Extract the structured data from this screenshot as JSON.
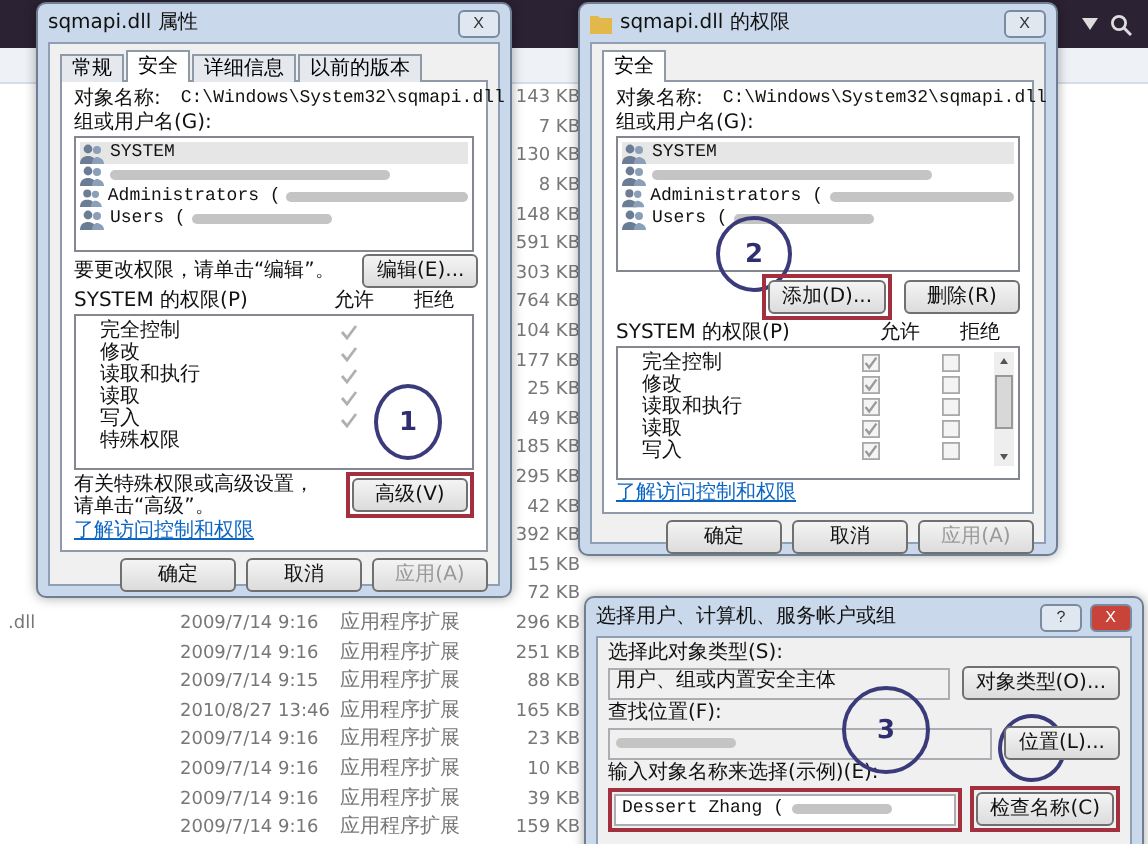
{
  "explorer": {
    "rows": [
      {
        "size": "143 KB"
      },
      {
        "size": "7 KB"
      },
      {
        "size": "130 KB"
      },
      {
        "size": "8 KB"
      },
      {
        "size": "148 KB"
      },
      {
        "size": "591 KB"
      },
      {
        "size": "303 KB"
      },
      {
        "size": "764 KB"
      },
      {
        "size": "104 KB"
      },
      {
        "size": "177 KB"
      },
      {
        "size": "25 KB"
      },
      {
        "size": "49 KB"
      },
      {
        "size": "185 KB"
      },
      {
        "size": "295 KB"
      },
      {
        "size": "42 KB"
      },
      {
        "size": "392 KB"
      },
      {
        "size": "15 KB"
      },
      {
        "size": "72 KB"
      },
      {
        "name": ".dll",
        "date": "2009/7/14 9:16",
        "type": "应用程序扩展",
        "size": "296 KB"
      },
      {
        "date": "2009/7/14 9:16",
        "type": "应用程序扩展",
        "size": "251 KB"
      },
      {
        "date": "2009/7/14 9:15",
        "type": "应用程序扩展",
        "size": "88 KB"
      },
      {
        "date": "2010/8/27 13:46",
        "type": "应用程序扩展",
        "size": "165 KB"
      },
      {
        "date": "2009/7/14 9:16",
        "type": "应用程序扩展",
        "size": "23 KB"
      },
      {
        "date": "2009/7/14 9:16",
        "type": "应用程序扩展",
        "size": "10 KB"
      },
      {
        "date": "2009/7/14 9:16",
        "type": "应用程序扩展",
        "size": "39 KB"
      },
      {
        "date": "2009/7/14 9:16",
        "type": "应用程序扩展",
        "size": "159 KB"
      }
    ]
  },
  "properties_dialog": {
    "title": "sqmapi.dll 属性",
    "close": "X",
    "tabs": [
      {
        "label": "常规",
        "selected": false
      },
      {
        "label": "安全",
        "selected": true
      },
      {
        "label": "详细信息",
        "selected": false
      },
      {
        "label": "以前的版本",
        "selected": false
      }
    ],
    "object_label": "对象名称:",
    "object_path": "C:\\Windows\\System32\\sqmapi.dll",
    "users_label": "组或用户名(G):",
    "users": [
      {
        "name": "SYSTEM",
        "blurred": false,
        "selected": true
      },
      {
        "blurred": true,
        "selected": false
      },
      {
        "name": "Administrators (",
        "blurred": true,
        "selected": false
      },
      {
        "name": "Users (",
        "blurred": true,
        "selected": false
      }
    ],
    "edit_hint": "要更改权限，请单击“编辑”。",
    "edit_button": {
      "label": "编辑(E)...",
      "highlighted": false
    },
    "perm_title": "SYSTEM 的权限(P)",
    "allow_header": "允许",
    "deny_header": "拒绝",
    "permissions": [
      {
        "label": "完全控制",
        "allow": true,
        "deny": false
      },
      {
        "label": "修改",
        "allow": true,
        "deny": false
      },
      {
        "label": "读取和执行",
        "allow": true,
        "deny": false
      },
      {
        "label": "读取",
        "allow": true,
        "deny": false
      },
      {
        "label": "写入",
        "allow": true,
        "deny": false
      },
      {
        "label": "特殊权限",
        "allow": false,
        "deny": false
      }
    ],
    "advanced_hint": "有关特殊权限或高级设置，请单击“高级”。",
    "advanced_button": {
      "label": "高级(V)",
      "highlighted": true
    },
    "link": "了解访问控制和权限",
    "annotation": "1",
    "buttons": [
      {
        "label": "确定",
        "disabled": false
      },
      {
        "label": "取消",
        "disabled": false
      },
      {
        "label": "应用(A)",
        "disabled": true
      }
    ]
  },
  "permissions_dialog": {
    "title": "sqmapi.dll 的权限",
    "close": "X",
    "tab": "安全",
    "object_label": "对象名称:",
    "object_path": "C:\\Windows\\System32\\sqmapi.dll",
    "users_label": "组或用户名(G):",
    "users": [
      {
        "name": "SYSTEM",
        "blurred": false,
        "selected": true
      },
      {
        "blurred": true,
        "selected": false
      },
      {
        "name": "Administrators (",
        "blurred": true,
        "selected": false
      },
      {
        "name": "Users (",
        "blurred": true,
        "selected": false
      }
    ],
    "add_button": {
      "label": "添加(D)...",
      "highlighted": true
    },
    "remove_button": {
      "label": "删除(R)",
      "highlighted": false
    },
    "perm_title": "SYSTEM 的权限(P)",
    "allow_header": "允许",
    "deny_header": "拒绝",
    "permissions": [
      {
        "label": "完全控制",
        "allow": true,
        "deny": false
      },
      {
        "label": "修改",
        "allow": true,
        "deny": false
      },
      {
        "label": "读取和执行",
        "allow": true,
        "deny": false
      },
      {
        "label": "读取",
        "allow": true,
        "deny": false
      },
      {
        "label": "写入",
        "allow": true,
        "deny": false
      }
    ],
    "link": "了解访问控制和权限",
    "annotation": "2",
    "buttons": [
      {
        "label": "确定",
        "disabled": false
      },
      {
        "label": "取消",
        "disabled": false
      },
      {
        "label": "应用(A)",
        "disabled": true
      }
    ]
  },
  "select_dialog": {
    "title": "选择用户、计算机、服务帐户或组",
    "help": "?",
    "close": "X",
    "type_label": "选择此对象类型(S):",
    "type_value": "用户、组或内置安全主体",
    "type_button": {
      "label": "对象类型(O)...",
      "highlighted": false
    },
    "location_label": "查找位置(F):",
    "location_button": {
      "label": "位置(L)...",
      "highlighted": false
    },
    "name_label": "输入对象名称来选择(示例)(E):",
    "name_value": "Dessert Zhang (",
    "check_button": {
      "label": "检查名称(C)",
      "highlighted": true
    },
    "annotation": "3"
  }
}
